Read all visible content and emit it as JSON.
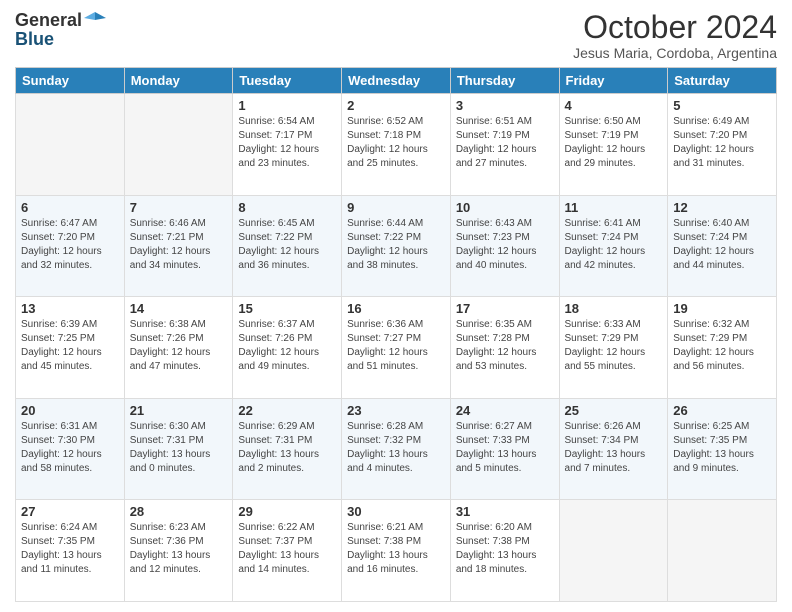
{
  "header": {
    "logo_general": "General",
    "logo_blue": "Blue",
    "month_title": "October 2024",
    "location": "Jesus Maria, Cordoba, Argentina"
  },
  "days_of_week": [
    "Sunday",
    "Monday",
    "Tuesday",
    "Wednesday",
    "Thursday",
    "Friday",
    "Saturday"
  ],
  "weeks": [
    [
      {
        "day": "",
        "info": ""
      },
      {
        "day": "",
        "info": ""
      },
      {
        "day": "1",
        "info": "Sunrise: 6:54 AM\nSunset: 7:17 PM\nDaylight: 12 hours\nand 23 minutes."
      },
      {
        "day": "2",
        "info": "Sunrise: 6:52 AM\nSunset: 7:18 PM\nDaylight: 12 hours\nand 25 minutes."
      },
      {
        "day": "3",
        "info": "Sunrise: 6:51 AM\nSunset: 7:19 PM\nDaylight: 12 hours\nand 27 minutes."
      },
      {
        "day": "4",
        "info": "Sunrise: 6:50 AM\nSunset: 7:19 PM\nDaylight: 12 hours\nand 29 minutes."
      },
      {
        "day": "5",
        "info": "Sunrise: 6:49 AM\nSunset: 7:20 PM\nDaylight: 12 hours\nand 31 minutes."
      }
    ],
    [
      {
        "day": "6",
        "info": "Sunrise: 6:47 AM\nSunset: 7:20 PM\nDaylight: 12 hours\nand 32 minutes."
      },
      {
        "day": "7",
        "info": "Sunrise: 6:46 AM\nSunset: 7:21 PM\nDaylight: 12 hours\nand 34 minutes."
      },
      {
        "day": "8",
        "info": "Sunrise: 6:45 AM\nSunset: 7:22 PM\nDaylight: 12 hours\nand 36 minutes."
      },
      {
        "day": "9",
        "info": "Sunrise: 6:44 AM\nSunset: 7:22 PM\nDaylight: 12 hours\nand 38 minutes."
      },
      {
        "day": "10",
        "info": "Sunrise: 6:43 AM\nSunset: 7:23 PM\nDaylight: 12 hours\nand 40 minutes."
      },
      {
        "day": "11",
        "info": "Sunrise: 6:41 AM\nSunset: 7:24 PM\nDaylight: 12 hours\nand 42 minutes."
      },
      {
        "day": "12",
        "info": "Sunrise: 6:40 AM\nSunset: 7:24 PM\nDaylight: 12 hours\nand 44 minutes."
      }
    ],
    [
      {
        "day": "13",
        "info": "Sunrise: 6:39 AM\nSunset: 7:25 PM\nDaylight: 12 hours\nand 45 minutes."
      },
      {
        "day": "14",
        "info": "Sunrise: 6:38 AM\nSunset: 7:26 PM\nDaylight: 12 hours\nand 47 minutes."
      },
      {
        "day": "15",
        "info": "Sunrise: 6:37 AM\nSunset: 7:26 PM\nDaylight: 12 hours\nand 49 minutes."
      },
      {
        "day": "16",
        "info": "Sunrise: 6:36 AM\nSunset: 7:27 PM\nDaylight: 12 hours\nand 51 minutes."
      },
      {
        "day": "17",
        "info": "Sunrise: 6:35 AM\nSunset: 7:28 PM\nDaylight: 12 hours\nand 53 minutes."
      },
      {
        "day": "18",
        "info": "Sunrise: 6:33 AM\nSunset: 7:29 PM\nDaylight: 12 hours\nand 55 minutes."
      },
      {
        "day": "19",
        "info": "Sunrise: 6:32 AM\nSunset: 7:29 PM\nDaylight: 12 hours\nand 56 minutes."
      }
    ],
    [
      {
        "day": "20",
        "info": "Sunrise: 6:31 AM\nSunset: 7:30 PM\nDaylight: 12 hours\nand 58 minutes."
      },
      {
        "day": "21",
        "info": "Sunrise: 6:30 AM\nSunset: 7:31 PM\nDaylight: 13 hours\nand 0 minutes."
      },
      {
        "day": "22",
        "info": "Sunrise: 6:29 AM\nSunset: 7:31 PM\nDaylight: 13 hours\nand 2 minutes."
      },
      {
        "day": "23",
        "info": "Sunrise: 6:28 AM\nSunset: 7:32 PM\nDaylight: 13 hours\nand 4 minutes."
      },
      {
        "day": "24",
        "info": "Sunrise: 6:27 AM\nSunset: 7:33 PM\nDaylight: 13 hours\nand 5 minutes."
      },
      {
        "day": "25",
        "info": "Sunrise: 6:26 AM\nSunset: 7:34 PM\nDaylight: 13 hours\nand 7 minutes."
      },
      {
        "day": "26",
        "info": "Sunrise: 6:25 AM\nSunset: 7:35 PM\nDaylight: 13 hours\nand 9 minutes."
      }
    ],
    [
      {
        "day": "27",
        "info": "Sunrise: 6:24 AM\nSunset: 7:35 PM\nDaylight: 13 hours\nand 11 minutes."
      },
      {
        "day": "28",
        "info": "Sunrise: 6:23 AM\nSunset: 7:36 PM\nDaylight: 13 hours\nand 12 minutes."
      },
      {
        "day": "29",
        "info": "Sunrise: 6:22 AM\nSunset: 7:37 PM\nDaylight: 13 hours\nand 14 minutes."
      },
      {
        "day": "30",
        "info": "Sunrise: 6:21 AM\nSunset: 7:38 PM\nDaylight: 13 hours\nand 16 minutes."
      },
      {
        "day": "31",
        "info": "Sunrise: 6:20 AM\nSunset: 7:38 PM\nDaylight: 13 hours\nand 18 minutes."
      },
      {
        "day": "",
        "info": ""
      },
      {
        "day": "",
        "info": ""
      }
    ]
  ]
}
